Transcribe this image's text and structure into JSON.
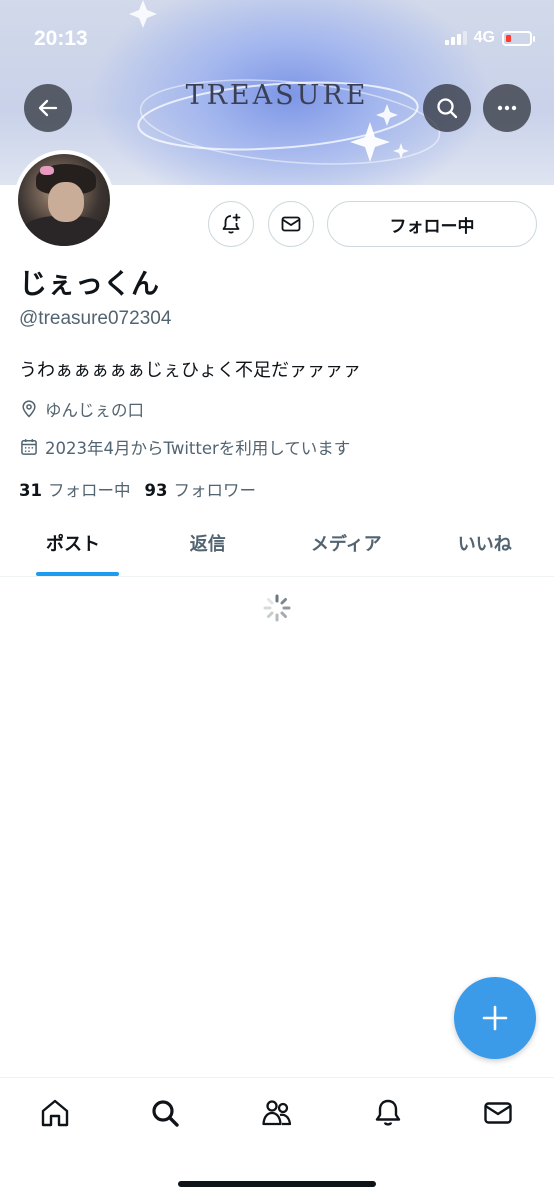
{
  "status_bar": {
    "time": "20:13",
    "network": "4G"
  },
  "banner": {
    "logo_text": "TREASURE"
  },
  "profile": {
    "display_name": "じぇっくん",
    "handle": "@treasure072304",
    "bio": "うわぁぁぁぁぁじぇひょく不足だァァァァ",
    "location": "ゆんじぇの口",
    "joined": "2023年4月からTwitterを利用しています",
    "following_count": "31",
    "following_label": "フォロー中",
    "followers_count": "93",
    "followers_label": "フォロワー"
  },
  "actions": {
    "follow_button_label": "フォロー中"
  },
  "tabs": [
    {
      "label": "ポスト",
      "active": true
    },
    {
      "label": "返信",
      "active": false
    },
    {
      "label": "メディア",
      "active": false
    },
    {
      "label": "いいね",
      "active": false
    }
  ],
  "icons": {
    "back": "arrow-left-icon",
    "search": "search-icon",
    "more": "more-icon",
    "notify": "bell-plus-icon",
    "message": "mail-icon",
    "location": "location-pin-icon",
    "calendar": "calendar-icon",
    "compose": "plus-icon"
  },
  "colors": {
    "accent": "#1d9bf0",
    "fab": "#3b9be9",
    "secondary_text": "#536471",
    "battery_low": "#ff3b30"
  }
}
